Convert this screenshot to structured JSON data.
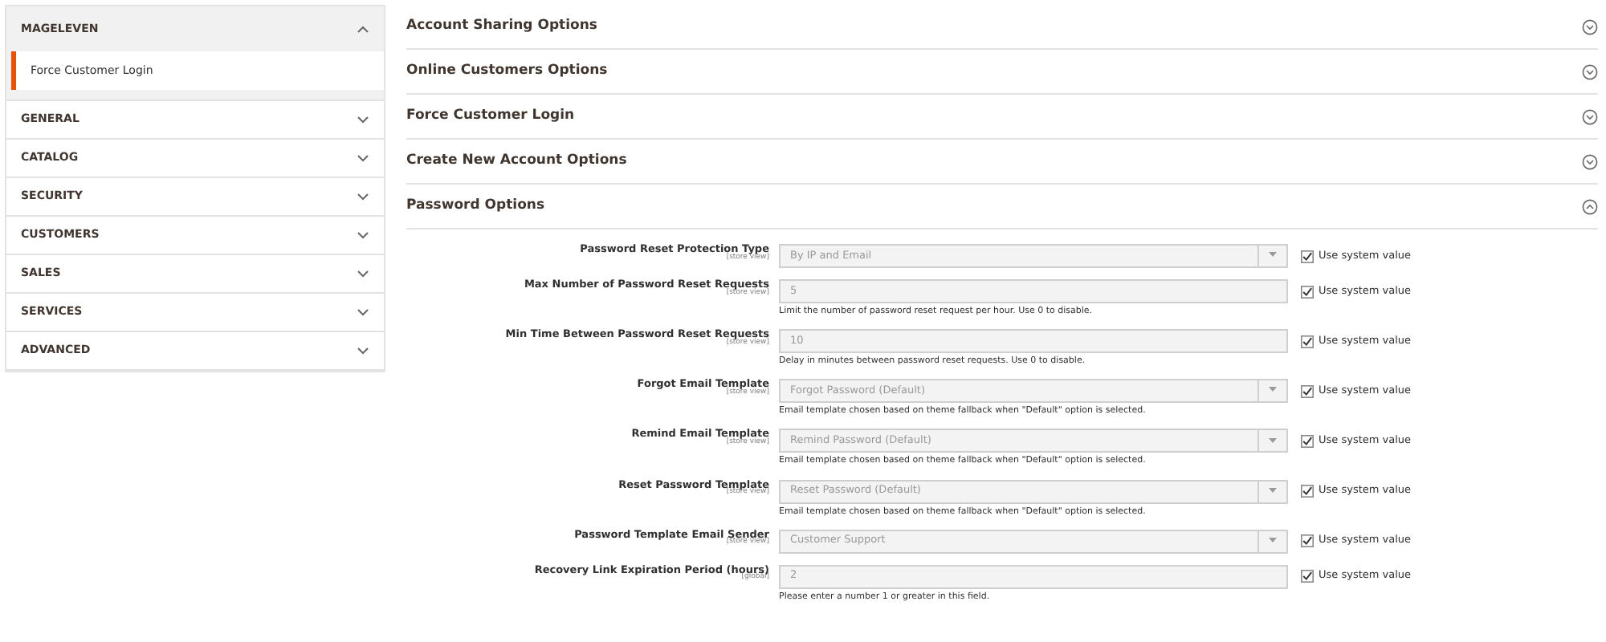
{
  "sidebar": {
    "groups": [
      {
        "label": "MAGELEVEN",
        "expanded": true,
        "items": [
          {
            "label": "Force Customer Login",
            "selected": true
          }
        ]
      },
      {
        "label": "GENERAL",
        "expanded": false
      },
      {
        "label": "CATALOG",
        "expanded": false
      },
      {
        "label": "SECURITY",
        "expanded": false
      },
      {
        "label": "CUSTOMERS",
        "expanded": false
      },
      {
        "label": "SALES",
        "expanded": false
      },
      {
        "label": "SERVICES",
        "expanded": false
      },
      {
        "label": "ADVANCED",
        "expanded": false
      }
    ]
  },
  "sections": [
    {
      "title": "Account Sharing Options",
      "expanded": false
    },
    {
      "title": "Online Customers Options",
      "expanded": false
    },
    {
      "title": "Force Customer Login",
      "expanded": false
    },
    {
      "title": "Create New Account Options",
      "expanded": false
    },
    {
      "title": "Password Options",
      "expanded": true,
      "fields": [
        {
          "label": "Password Reset Protection Type",
          "scope": "[store view]",
          "kind": "select",
          "value": "By IP and Email",
          "use_system": "Use system value",
          "checked": true
        },
        {
          "label": "Max Number of Password Reset Requests",
          "scope": "[store view]",
          "kind": "text",
          "value": "5",
          "note": "Limit the number of password reset request per hour. Use 0 to disable.",
          "use_system": "Use system value",
          "checked": true
        },
        {
          "label": "Min Time Between Password Reset Requests",
          "scope": "[store view]",
          "kind": "text",
          "value": "10",
          "note": "Delay in minutes between password reset requests. Use 0 to disable.",
          "use_system": "Use system value",
          "checked": true
        },
        {
          "label": "Forgot Email Template",
          "scope": "[store view]",
          "kind": "select",
          "value": "Forgot Password (Default)",
          "note": "Email template chosen based on theme fallback when \"Default\" option is selected.",
          "use_system": "Use system value",
          "checked": true
        },
        {
          "label": "Remind Email Template",
          "scope": "[store view]",
          "kind": "select",
          "value": "Remind Password (Default)",
          "note": "Email template chosen based on theme fallback when \"Default\" option is selected.",
          "use_system": "Use system value",
          "checked": true
        },
        {
          "label": "Reset Password Template",
          "scope": "[store view]",
          "kind": "select",
          "value": "Reset Password (Default)",
          "note": "Email template chosen based on theme fallback when \"Default\" option is selected.",
          "use_system": "Use system value",
          "checked": true
        },
        {
          "label": "Password Template Email Sender",
          "scope": "[store view]",
          "kind": "select",
          "value": "Customer Support",
          "use_system": "Use system value",
          "checked": true
        },
        {
          "label": "Recovery Link Expiration Period (hours)",
          "scope": "[global]",
          "kind": "text",
          "value": "2",
          "note": "Please enter a number 1 or greater in this field.",
          "use_system": "Use system value",
          "checked": true
        }
      ]
    }
  ]
}
